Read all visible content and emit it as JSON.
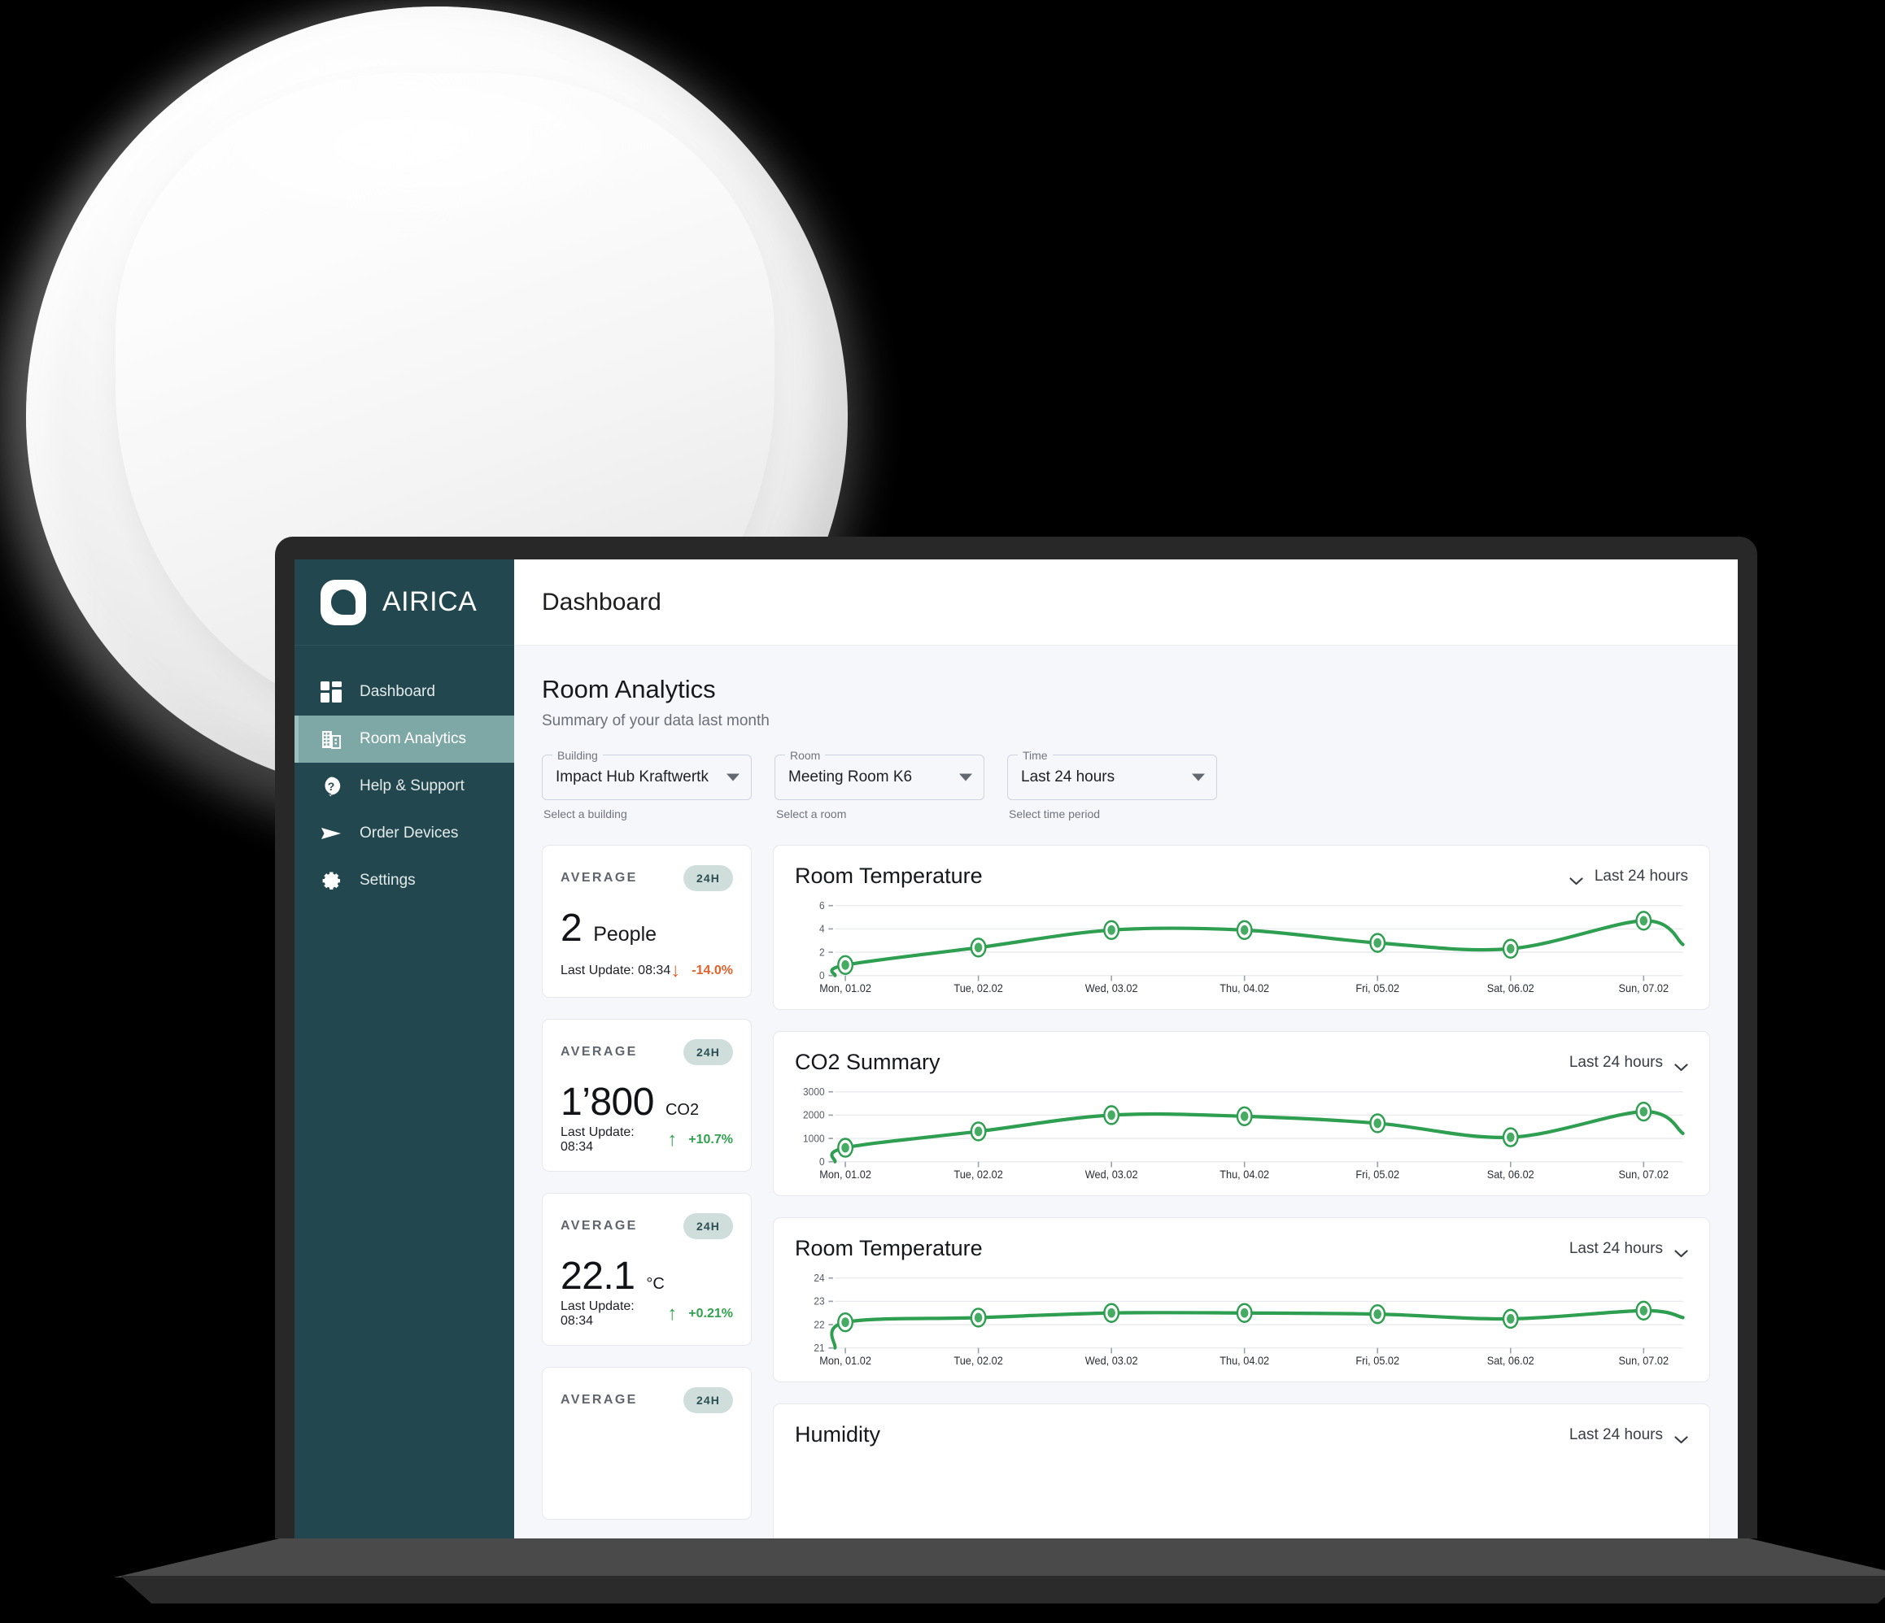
{
  "brand": {
    "name": "AIRICA",
    "logo_icon": "airica-droplet-logo",
    "sidebar_color": "#22474e",
    "active_color": "#7ea8a6"
  },
  "sidebar": {
    "items": [
      {
        "label": "Dashboard",
        "icon": "dashboard-grid-icon",
        "active": false
      },
      {
        "label": "Room Analytics",
        "icon": "building-icon",
        "active": true
      },
      {
        "label": "Help & Support",
        "icon": "help-circle-icon",
        "active": false
      },
      {
        "label": "Order Devices",
        "icon": "send-paper-plane-icon",
        "active": false
      },
      {
        "label": "Settings",
        "icon": "gear-icon",
        "active": false
      }
    ]
  },
  "topbar": {
    "title": "Dashboard"
  },
  "section": {
    "title": "Room Analytics",
    "subtitle": "Summary of your data last month"
  },
  "filters": [
    {
      "legend": "Building",
      "value": "Impact Hub Kraftwertk",
      "helper": "Select a building",
      "icon": "chevron-down-icon"
    },
    {
      "legend": "Room",
      "value": "Meeting Room K6",
      "helper": "Select a room",
      "icon": "chevron-down-icon"
    },
    {
      "legend": "Time",
      "value": "Last 24 hours",
      "helper": "Select time period",
      "icon": "chevron-down-icon"
    }
  ],
  "stats": [
    {
      "label": "AVERAGE",
      "badge": "24H",
      "value": "2",
      "unit": "People",
      "unit_size": "normal",
      "last_update": "Last Update: 08:34",
      "trend_arrow": "↓",
      "trend_value": "-14.0%",
      "trend_direction": "down",
      "trend_color": "#e2622a"
    },
    {
      "label": "AVERAGE",
      "badge": "24H",
      "value": "1’800",
      "unit": "CO2",
      "unit_size": "small",
      "last_update": "Last Update: 08:34",
      "trend_arrow": "↑",
      "trend_value": "+10.7%",
      "trend_direction": "up",
      "trend_color": "#2fa24d"
    },
    {
      "label": "AVERAGE",
      "badge": "24H",
      "value": "22.1",
      "unit": "°C",
      "unit_size": "small",
      "last_update": "Last Update: 08:34",
      "trend_arrow": "↑",
      "trend_value": "+0.21%",
      "trend_direction": "up",
      "trend_color": "#2fa24d"
    },
    {
      "label": "AVERAGE",
      "badge": "24H",
      "value": "",
      "unit": "",
      "unit_size": "normal",
      "last_update": "",
      "trend_arrow": "",
      "trend_value": "",
      "trend_direction": "up",
      "trend_color": "#2fa24d"
    }
  ],
  "charts": [
    {
      "title": "Room Temperature",
      "range": "Last 24 hours",
      "chevron_side": "left",
      "icon": "chevron-down-icon"
    },
    {
      "title": "CO2 Summary",
      "range": "Last 24 hours",
      "chevron_side": "right",
      "icon": "chevron-down-icon"
    },
    {
      "title": "Room Temperature",
      "range": "Last 24 hours",
      "chevron_side": "right",
      "icon": "chevron-down-icon"
    },
    {
      "title": "Humidity",
      "range": "Last 24 hours",
      "chevron_side": "right",
      "icon": "chevron-down-icon"
    }
  ],
  "chart_data": [
    {
      "type": "line",
      "title": "Room Temperature",
      "xlabel": "",
      "ylabel": "",
      "categories": [
        "Mon, 01.02",
        "Tue, 02.02",
        "Wed, 03.02",
        "Thu, 04.02",
        "Fri, 05.02",
        "Sat, 06.02",
        "Sun, 07.02"
      ],
      "values": [
        0.9,
        2.4,
        3.9,
        3.9,
        2.8,
        2.3,
        4.7
      ],
      "yticks": [
        0,
        2,
        4,
        6
      ],
      "ylim": [
        0,
        6
      ],
      "grid": true,
      "legend": "none",
      "series_color": "#2e9e50"
    },
    {
      "type": "line",
      "title": "CO2 Summary",
      "xlabel": "",
      "ylabel": "",
      "categories": [
        "Mon, 01.02",
        "Tue, 02.02",
        "Wed, 03.02",
        "Thu, 04.02",
        "Fri, 05.02",
        "Sat, 06.02",
        "Sun, 07.02"
      ],
      "values": [
        600,
        1300,
        2000,
        1950,
        1650,
        1050,
        2150
      ],
      "yticks": [
        0,
        1000,
        2000,
        3000
      ],
      "ylim": [
        0,
        3000
      ],
      "grid": true,
      "legend": "none",
      "series_color": "#2e9e50"
    },
    {
      "type": "line",
      "title": "Room Temperature",
      "xlabel": "",
      "ylabel": "",
      "categories": [
        "Mon, 01.02",
        "Tue, 02.02",
        "Wed, 03.02",
        "Thu, 04.02",
        "Fri, 05.02",
        "Sat, 06.02",
        "Sun, 07.02"
      ],
      "values": [
        22.1,
        22.3,
        22.5,
        22.5,
        22.45,
        22.25,
        22.6
      ],
      "yticks": [
        21,
        22,
        23,
        24
      ],
      "ylim": [
        21,
        24
      ],
      "grid": true,
      "legend": "none",
      "series_color": "#2e9e50"
    },
    {
      "type": "line",
      "title": "Humidity",
      "xlabel": "",
      "ylabel": "",
      "categories": [],
      "values": [],
      "yticks": [],
      "ylim": [
        0,
        100
      ],
      "grid": true,
      "legend": "none",
      "series_color": "#2e9e50"
    }
  ]
}
